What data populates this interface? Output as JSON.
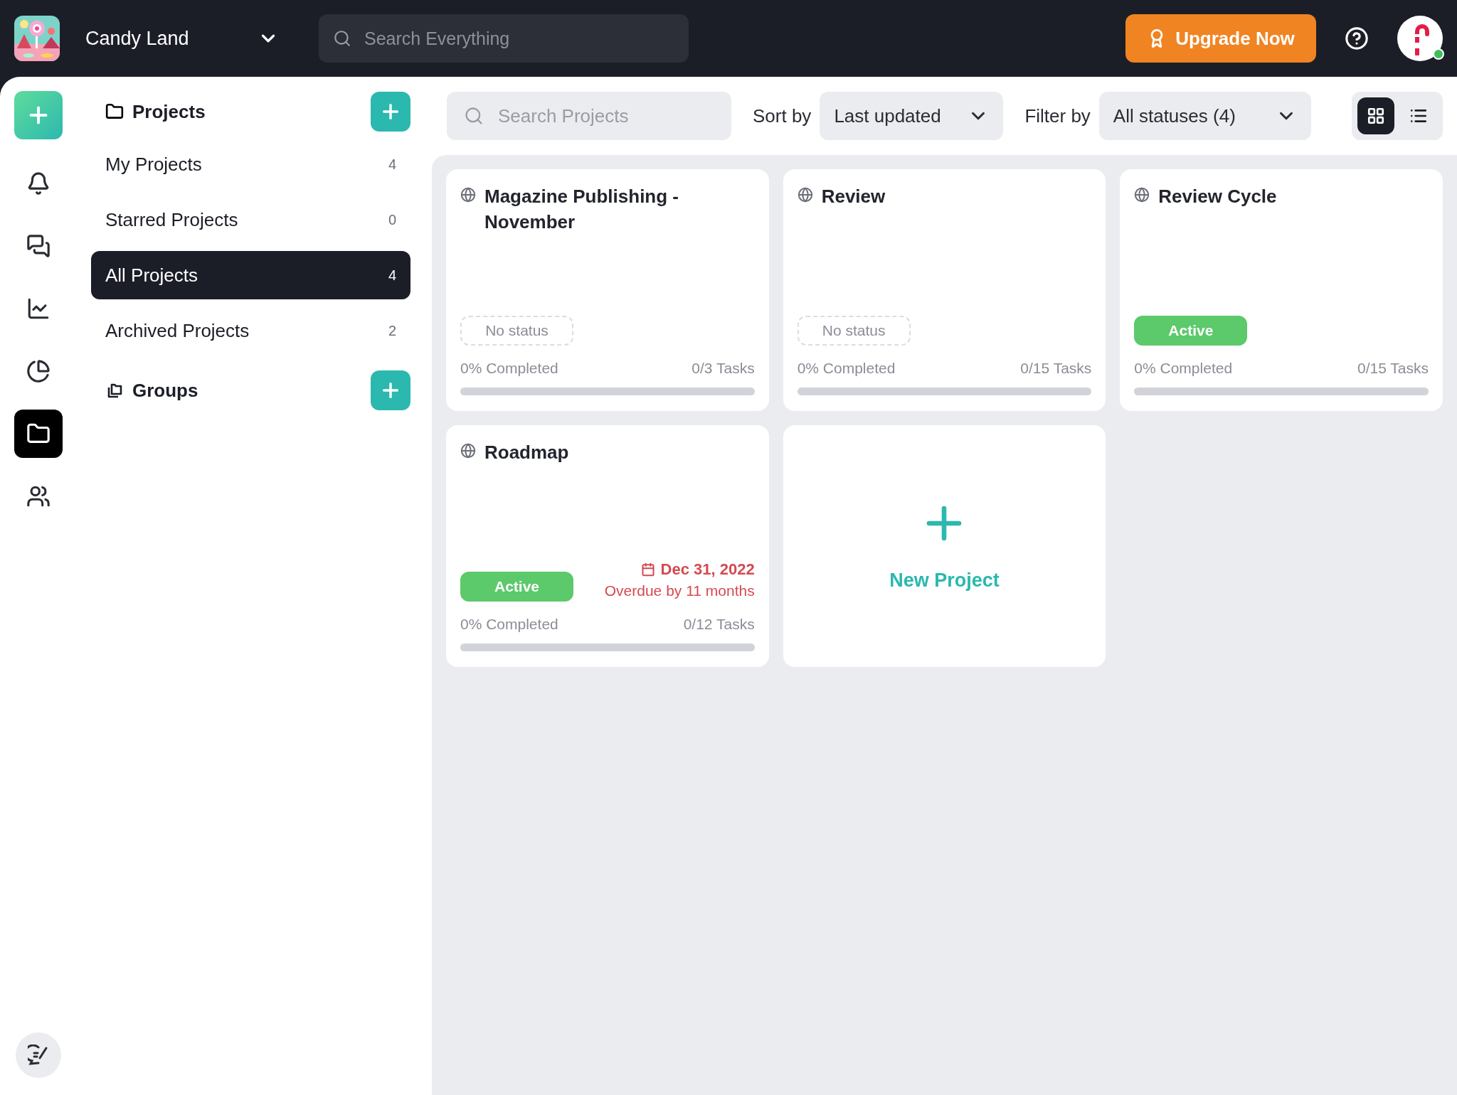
{
  "workspace": {
    "name": "Candy Land"
  },
  "top_search": {
    "placeholder": "Search Everything"
  },
  "upgrade_button": "Upgrade Now",
  "user": {
    "online": true
  },
  "rail": [
    {
      "kind": "notifications",
      "selected": false
    },
    {
      "kind": "messages",
      "selected": false
    },
    {
      "kind": "reports",
      "selected": false
    },
    {
      "kind": "time",
      "selected": false
    },
    {
      "kind": "projects",
      "selected": true
    },
    {
      "kind": "people",
      "selected": false
    }
  ],
  "sidebar": {
    "projects_title": "Projects",
    "items": [
      {
        "label": "My Projects",
        "count": "4",
        "selected": false
      },
      {
        "label": "Starred Projects",
        "count": "0",
        "selected": false
      },
      {
        "label": "All Projects",
        "count": "4",
        "selected": true
      },
      {
        "label": "Archived Projects",
        "count": "2",
        "selected": false
      }
    ],
    "groups_title": "Groups"
  },
  "toolbar": {
    "search_placeholder": "Search Projects",
    "sort_label": "Sort by",
    "sort_value": "Last updated",
    "filter_label": "Filter by",
    "filter_value": "All statuses (4)",
    "views": [
      {
        "kind": "grid",
        "selected": true
      },
      {
        "kind": "list",
        "selected": false
      }
    ]
  },
  "projects": [
    {
      "title": "Magazine Publishing - November",
      "status": {
        "kind": "none",
        "label": "No status"
      },
      "completed": "0% Completed",
      "tasks": "0/3 Tasks",
      "level": 0
    },
    {
      "title": "Review",
      "status": {
        "kind": "none",
        "label": "No status"
      },
      "completed": "0% Completed",
      "tasks": "0/15 Tasks",
      "level": 0
    },
    {
      "title": "Review Cycle",
      "status": {
        "kind": "active",
        "label": "Active"
      },
      "completed": "0% Completed",
      "tasks": "0/15 Tasks",
      "level": 0
    },
    {
      "title": "Roadmap",
      "status": {
        "kind": "active",
        "label": "Active"
      },
      "due": {
        "date": "Dec 31, 2022",
        "note": "Overdue by 11 months"
      },
      "completed": "0% Completed",
      "tasks": "0/12 Tasks",
      "level": 0
    }
  ],
  "new_project": "New Project"
}
